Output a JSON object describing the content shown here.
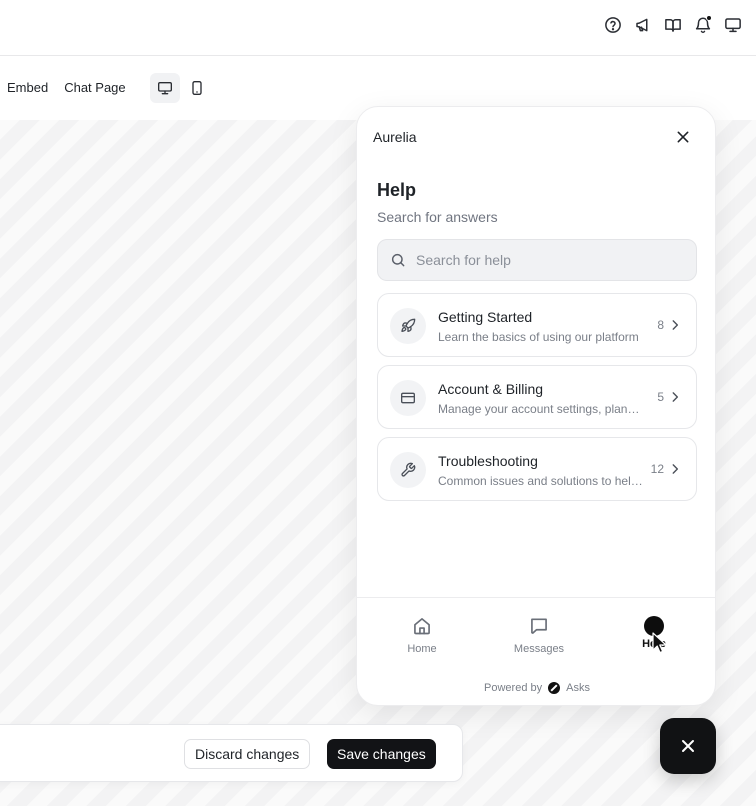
{
  "toolbar": {
    "tabs": [
      "Embed",
      "Chat Page"
    ]
  },
  "topbar": {
    "icons": [
      "help-icon",
      "megaphone-icon",
      "book-icon",
      "bell-icon",
      "monitor-icon"
    ]
  },
  "widget": {
    "brand": "Aurelia",
    "title": "Help",
    "subtitle": "Search for answers",
    "search_placeholder": "Search for help",
    "categories": [
      {
        "title": "Getting Started",
        "description": "Learn the basics of using our platform",
        "count": "8",
        "icon": "rocket-icon"
      },
      {
        "title": "Account & Billing",
        "description": "Manage your account settings, plans and billing",
        "count": "5",
        "icon": "credit-card-icon"
      },
      {
        "title": "Troubleshooting",
        "description": "Common issues and solutions to help you",
        "count": "12",
        "icon": "wrench-icon"
      }
    ],
    "nav": [
      {
        "label": "Home",
        "icon": "home-icon"
      },
      {
        "label": "Messages",
        "icon": "message-icon"
      },
      {
        "label": "Help",
        "icon": "help-icon",
        "active": true
      }
    ],
    "powered_by": "Powered by",
    "powered_brand": "Asks"
  },
  "savebar": {
    "discard_label": "Discard changes",
    "save_label": "Save changes"
  }
}
